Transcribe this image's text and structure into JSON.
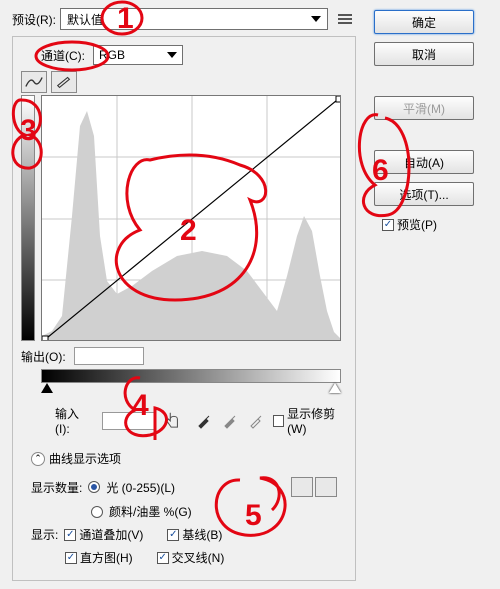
{
  "preset": {
    "label": "预设(R):",
    "value": "默认值"
  },
  "channel": {
    "label": "通道(C):",
    "value": "RGB"
  },
  "output": {
    "label": "输出(O):",
    "value": ""
  },
  "input": {
    "label": "输入(I):",
    "value": ""
  },
  "showClipping": "显示修剪(W)",
  "curveDisplayOptions": "曲线显示选项",
  "showAmount": {
    "label": "显示数量:",
    "optLight": "光 (0-255)(L)",
    "optPigment": "颜料/油墨 %(G)"
  },
  "show": {
    "label": "显示:",
    "channelOverlay": "通道叠加(V)",
    "histogram": "直方图(H)",
    "baseline": "基线(B)",
    "intersection": "交叉线(N)"
  },
  "buttons": {
    "ok": "确定",
    "cancel": "取消",
    "smooth": "平滑(M)",
    "auto": "自动(A)",
    "options": "选项(T)...",
    "preview": "预览(P)"
  }
}
